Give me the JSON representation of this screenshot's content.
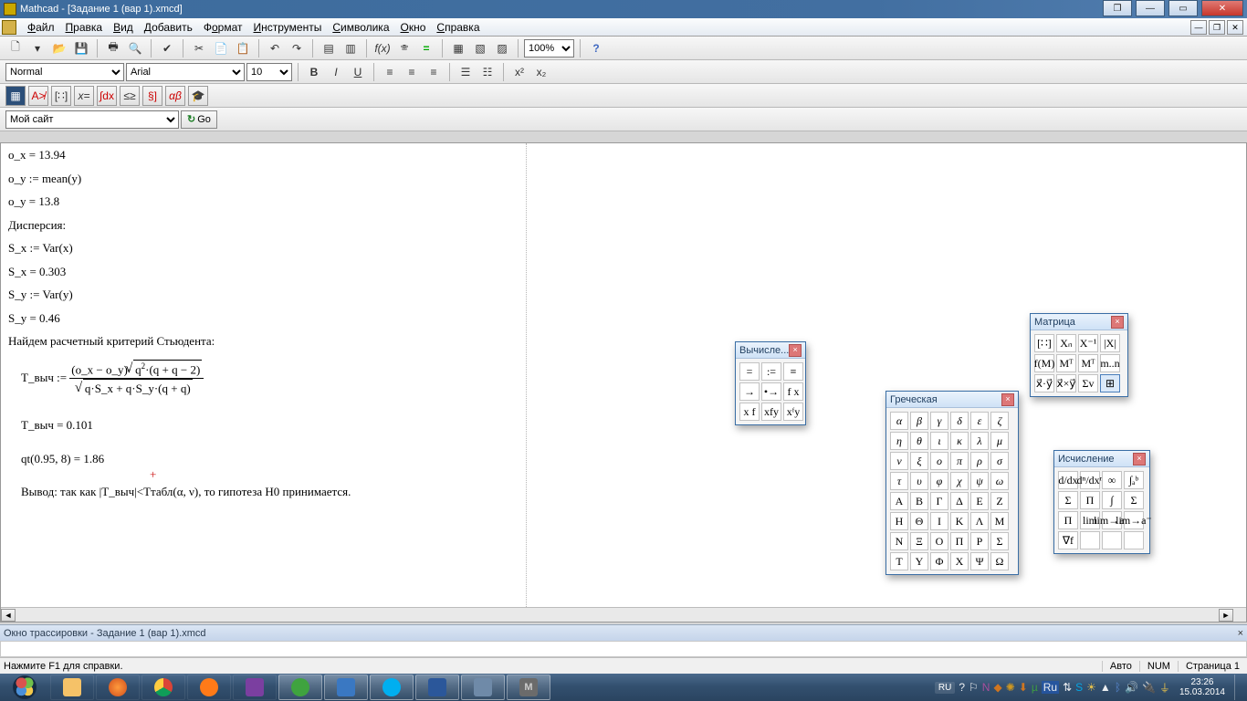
{
  "window": {
    "title": "Mathcad - [Задание 1 (вар 1).xmcd]"
  },
  "menu": {
    "items": [
      "Файл",
      "Правка",
      "Вид",
      "Добавить",
      "Формат",
      "Инструменты",
      "Символика",
      "Окно",
      "Справка"
    ]
  },
  "toolbar_main": {
    "zoom": "100%"
  },
  "toolbar_fmt": {
    "style": "Normal",
    "font": "Arial",
    "size": "10"
  },
  "toolbar_web": {
    "site": "Мой сайт",
    "go": "Go"
  },
  "doc": {
    "l1": "о_x = 13.94",
    "l2": "о_y := mean(y)",
    "l3": "о_y = 13.8",
    "l4": "Дисперсия:",
    "l5": "S_x := Var(x)",
    "l6": "S_x = 0.303",
    "l7": "S_y := Var(y)",
    "l8": "S_y = 0.46",
    "l9": "Найдем расчетный критерий Стьюдента:",
    "tvych_lhs": "Т_выч := ",
    "tvych_num_a": "(о_x − о_y)·",
    "tvych_num_b": "q",
    "tvych_num_c": "·(q + q − 2)",
    "tvych_den": "q·S_x + q·S_y·(q + q)",
    "l11": "Т_выч = 0.101",
    "l12": "qt(0.95, 8) = 1.86",
    "l13": "Вывод: так как |T_выч|<Tтабл(α, ν), то гипотеза H0 принимается."
  },
  "palettes": {
    "eval": {
      "title": "Вычисле...",
      "cells": [
        "=",
        ":=",
        "≡",
        "→",
        "•→",
        "f x",
        "x f",
        "xfy",
        "xᶠy"
      ]
    },
    "greek": {
      "title": "Греческая",
      "lower": [
        "α",
        "β",
        "γ",
        "δ",
        "ε",
        "ζ",
        "η",
        "θ",
        "ι",
        "κ",
        "λ",
        "μ",
        "ν",
        "ξ",
        "ο",
        "π",
        "ρ",
        "σ",
        "τ",
        "υ",
        "φ",
        "χ",
        "ψ",
        "ω"
      ],
      "upper": [
        "Α",
        "Β",
        "Γ",
        "Δ",
        "Ε",
        "Ζ",
        "Η",
        "Θ",
        "Ι",
        "Κ",
        "Λ",
        "Μ",
        "Ν",
        "Ξ",
        "Ο",
        "Π",
        "Ρ",
        "Σ",
        "Τ",
        "Υ",
        "Φ",
        "Χ",
        "Ψ",
        "Ω"
      ]
    },
    "matrix": {
      "title": "Матрица",
      "cells": [
        "[∷]",
        "Xₙ",
        "X⁻¹",
        "|X|",
        "f(M)",
        "Mᵀ",
        "Mᵀ",
        "m..n",
        "x⃗·y⃗",
        "x⃗×y⃗",
        "Σv",
        "⊞"
      ]
    },
    "calc": {
      "title": "Исчисление",
      "cells": [
        "d/dx",
        "dⁿ/dxⁿ",
        "∞",
        "∫ₐᵇ",
        "Σ",
        "Π",
        "∫",
        "Σ",
        "Π",
        "lim",
        "lim→a⁺",
        "lim→a⁻",
        "∇f",
        "",
        "",
        ""
      ]
    }
  },
  "trace": {
    "title": "Окно трассировки - Задание 1 (вар 1).xmcd"
  },
  "status": {
    "hint": "Нажмите F1 для справки.",
    "auto": "Авто",
    "num": "NUM",
    "page": "Страница 1"
  },
  "taskbar": {
    "lang": "RU",
    "time": "23:26",
    "date": "15.03.2014"
  }
}
